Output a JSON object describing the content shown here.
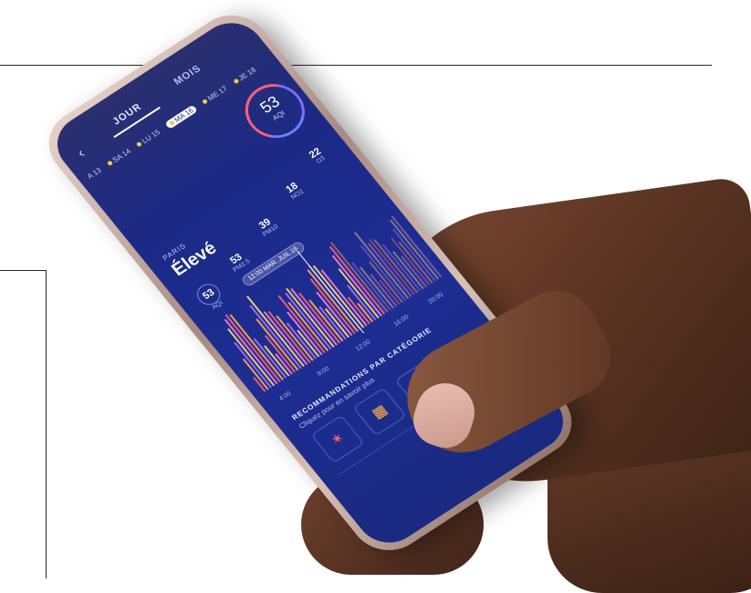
{
  "phone_app": {
    "tabs": [
      "JOUR",
      "MOIS"
    ],
    "days": [
      "A 13",
      "SA 14",
      "LU 15",
      "MA 16",
      "ME 17",
      "JE 18"
    ],
    "aqi": {
      "value": "53",
      "label": "AQI"
    },
    "city": "PARIS",
    "level": "Élevé",
    "pollutants": [
      {
        "value": "53",
        "label": "AQI"
      },
      {
        "value": "53",
        "label": "PM2.5"
      },
      {
        "value": "39",
        "label": "PM10"
      },
      {
        "value": "18",
        "label": "NO2"
      },
      {
        "value": "22",
        "label": "O3"
      }
    ],
    "chart_tooltip": "12:00 MAR. JUIL.16",
    "chart_ticks": [
      "4:00",
      "8:00",
      "12:00",
      "16:00",
      "20:00"
    ],
    "recommendations": {
      "title": "RECOMMANDATIONS PAR CATÉGORIE",
      "subtitle": "Cliquez pour en savoir plus"
    }
  },
  "colors": {
    "screen": "#1d2d93",
    "accent_pink": "#ff5f7e",
    "accent_purple": "#7c6cff"
  }
}
